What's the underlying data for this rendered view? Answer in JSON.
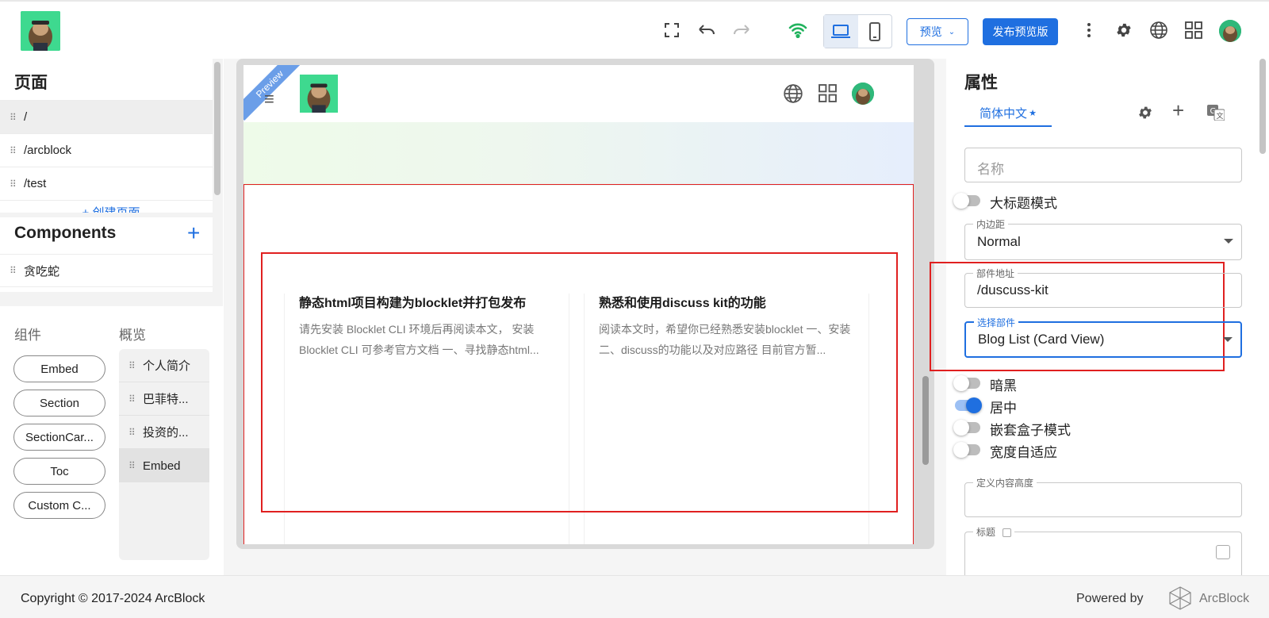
{
  "toolbar": {
    "preview_label": "预览",
    "publish_label": "发布预览版"
  },
  "pages_panel": {
    "title": "页面",
    "items": [
      "/",
      "/arcblock",
      "/test"
    ],
    "create_label": "+ 创建页面"
  },
  "components_panel": {
    "title": "Components",
    "items": [
      "贪吃蛇"
    ]
  },
  "library": {
    "tabs": [
      "组件",
      "概览"
    ],
    "components": [
      "Embed",
      "Section",
      "SectionCar...",
      "Toc",
      "Custom C..."
    ],
    "overview": [
      "个人简介",
      "巴菲特...",
      "投资的...",
      "Embed"
    ]
  },
  "canvas": {
    "ribbon": "Preview",
    "cards": [
      {
        "title": "静态html项目构建为blocklet并打包发布",
        "desc": "请先安装 Blocklet CLI 环境后再阅读本文， 安装 Blocklet CLI 可参考官方文档 一、寻找静态html..."
      },
      {
        "title": "熟悉和使用discuss kit的功能",
        "desc": "阅读本文时，希望你已经熟悉安装blocklet 一、安装 二、discuss的功能以及对应路径 目前官方暂..."
      }
    ]
  },
  "properties": {
    "title": "属性",
    "language_tab": "简体中文",
    "name_placeholder": "名称",
    "big_title_mode": "大标题模式",
    "padding_label": "内边距",
    "padding_value": "Normal",
    "component_path_label": "部件地址",
    "component_path_value": "/duscuss-kit",
    "select_component_label": "选择部件",
    "select_component_value": "Blog List (Card View)",
    "toggles": [
      {
        "label": "暗黑",
        "on": false
      },
      {
        "label": "居中",
        "on": true
      },
      {
        "label": "嵌套盒子模式",
        "on": false
      },
      {
        "label": "宽度自适应",
        "on": false
      }
    ],
    "content_height_label": "定义内容高度",
    "heading_label": "标题"
  },
  "footer": {
    "copyright": "Copyright © 2017-2024  ArcBlock",
    "powered_by": "Powered by",
    "brand": "ArcBlock"
  },
  "colors": {
    "accent": "#1f6fe0",
    "highlight_border": "#e02020",
    "wifi": "#22b35e"
  }
}
